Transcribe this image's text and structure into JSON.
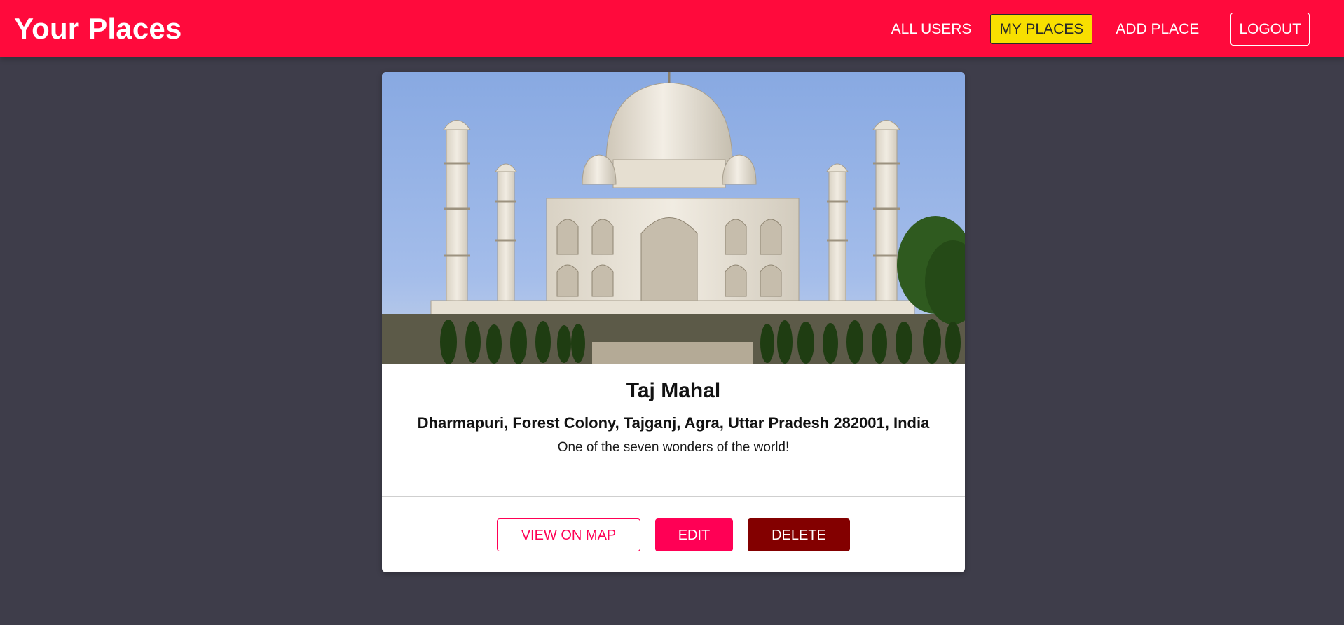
{
  "header": {
    "brand": "Your Places",
    "nav": {
      "all_users": "ALL USERS",
      "my_places": "MY PLACES",
      "add_place": "ADD PLACE",
      "logout": "LOGOUT"
    },
    "active_nav": "my_places"
  },
  "place": {
    "image_alt": "Taj Mahal",
    "title": "Taj Mahal",
    "address": "Dharmapuri, Forest Colony, Tajganj, Agra, Uttar Pradesh 282001, India",
    "description": "One of the seven wonders of the world!"
  },
  "actions": {
    "view_on_map": "VIEW ON MAP",
    "edit": "EDIT",
    "delete": "DELETE"
  },
  "colors": {
    "header_bg": "#ff0a3c",
    "page_bg": "#3e3d4a",
    "active_nav_bg": "#f8df00",
    "primary": "#ff0055",
    "danger": "#830000"
  }
}
